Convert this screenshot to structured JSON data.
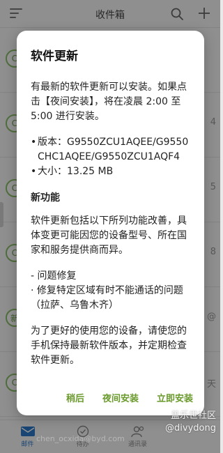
{
  "app": {
    "title": "收件箱",
    "rows": [
      {
        "avatar": "C",
        "side": ""
      },
      {
        "avatar": "C",
        "side": "4"
      },
      {
        "avatar": "C",
        "side": "5"
      },
      {
        "avatar": "C",
        "side": "8"
      },
      {
        "avatar": "新",
        "side": "@"
      },
      {
        "avatar": "C",
        "side": "天"
      }
    ],
    "bottom_nav": [
      {
        "label": "邮件",
        "active": true
      },
      {
        "label": "待办",
        "active": false
      },
      {
        "label": "通讯录",
        "active": false
      },
      {
        "label": "",
        "active": false
      }
    ]
  },
  "dialog": {
    "title": "软件更新",
    "intro": "有最新的软件更新可以安装。如果点击【夜间安装】，将在凌晨 2:00 至 5:00 进行安装。",
    "version_label": "版本：G9550ZCU1AQEE/G9550CHC1AQEE/G9550ZCU1AQF4",
    "size_label": "大小：13.25 MB",
    "features_title": "新功能",
    "features_body": "软件更新包括以下所列功能改善，具体变更可能因您的设备型号、所在国家和服务提供商而异。",
    "fix_heading": "- 问题修复",
    "fix_item": "· 修复特定区域有时不能通话的问题（拉萨、乌鲁木齐）",
    "closing": "为了更好的使用您的设备，请使您的手机保持最新软件版本，并定期检查软件更新。",
    "buttons": {
      "later": "稍后",
      "night_install": "夜间安装",
      "install_now": "立即安装"
    }
  },
  "watermark": {
    "line1": "盖乐世社区",
    "line2": "@divydong",
    "faint": "chen_ocxida@byd.com"
  },
  "colors": {
    "accent_green": "#6a9a2c",
    "active_blue": "#2a78c8",
    "scrim": "rgba(0,0,0,0.42)"
  }
}
